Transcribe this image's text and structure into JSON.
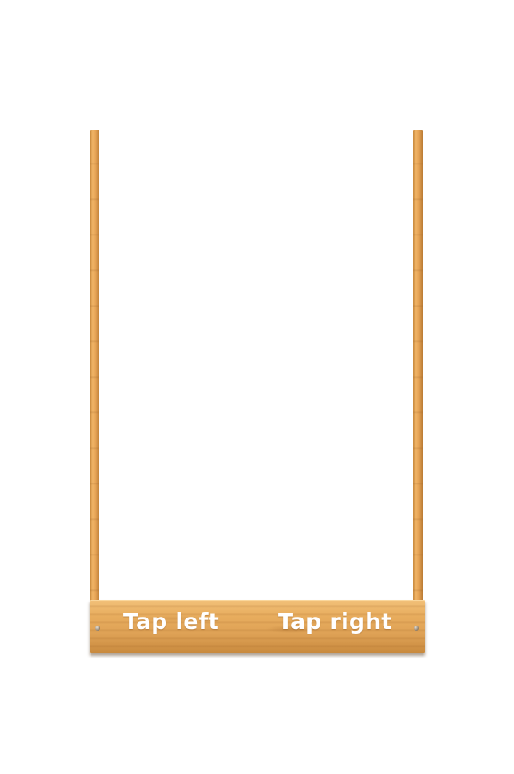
{
  "controls": {
    "left_label": "Tap left",
    "right_label": "Tap right"
  },
  "colors": {
    "background": "#ffffff",
    "wood_light": "#f0b466",
    "wood_dark": "#c98a3e",
    "label_text": "#ffffff"
  }
}
